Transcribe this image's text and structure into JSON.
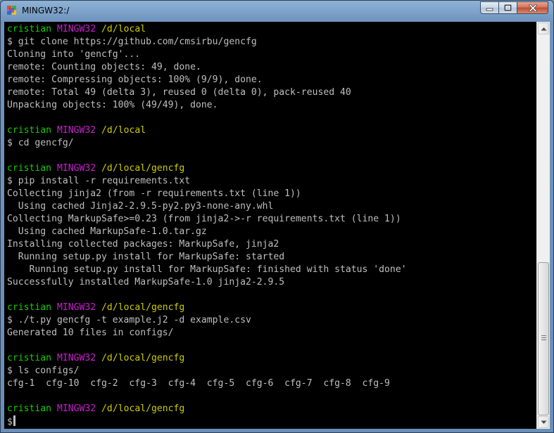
{
  "window": {
    "title": "MINGW32:/",
    "icon": "mingw-terminal-icon",
    "controls": [
      "minimize-icon",
      "maximize-icon",
      "close-icon"
    ]
  },
  "terminal": {
    "colors": {
      "user": "#19cb00",
      "host": "#cb1ed1",
      "path": "#cdcb00",
      "text": "#bfbfbf",
      "background": "#000000"
    },
    "lines": [
      {
        "type": "prompt",
        "user": "cristian",
        "host": "MINGW32",
        "path": "/d/local"
      },
      {
        "type": "text",
        "text": "$ git clone https://github.com/cmsirbu/gencfg"
      },
      {
        "type": "text",
        "text": "Cloning into 'gencfg'..."
      },
      {
        "type": "text",
        "text": "remote: Counting objects: 49, done."
      },
      {
        "type": "text",
        "text": "remote: Compressing objects: 100% (9/9), done."
      },
      {
        "type": "text",
        "text": "remote: Total 49 (delta 3), reused 0 (delta 0), pack-reused 40"
      },
      {
        "type": "text",
        "text": "Unpacking objects: 100% (49/49), done."
      },
      {
        "type": "text",
        "text": ""
      },
      {
        "type": "prompt",
        "user": "cristian",
        "host": "MINGW32",
        "path": "/d/local"
      },
      {
        "type": "text",
        "text": "$ cd gencfg/"
      },
      {
        "type": "text",
        "text": ""
      },
      {
        "type": "prompt",
        "user": "cristian",
        "host": "MINGW32",
        "path": "/d/local/gencfg"
      },
      {
        "type": "text",
        "text": "$ pip install -r requirements.txt"
      },
      {
        "type": "text",
        "text": "Collecting jinja2 (from -r requirements.txt (line 1))"
      },
      {
        "type": "text",
        "text": "  Using cached Jinja2-2.9.5-py2.py3-none-any.whl"
      },
      {
        "type": "text",
        "text": "Collecting MarkupSafe>=0.23 (from jinja2->-r requirements.txt (line 1))"
      },
      {
        "type": "text",
        "text": "  Using cached MarkupSafe-1.0.tar.gz"
      },
      {
        "type": "text",
        "text": "Installing collected packages: MarkupSafe, jinja2"
      },
      {
        "type": "text",
        "text": "  Running setup.py install for MarkupSafe: started"
      },
      {
        "type": "text",
        "text": "    Running setup.py install for MarkupSafe: finished with status 'done'"
      },
      {
        "type": "text",
        "text": "Successfully installed MarkupSafe-1.0 jinja2-2.9.5"
      },
      {
        "type": "text",
        "text": ""
      },
      {
        "type": "prompt",
        "user": "cristian",
        "host": "MINGW32",
        "path": "/d/local/gencfg"
      },
      {
        "type": "text",
        "text": "$ ./t.py gencfg -t example.j2 -d example.csv"
      },
      {
        "type": "text",
        "text": "Generated 10 files in configs/"
      },
      {
        "type": "text",
        "text": ""
      },
      {
        "type": "prompt",
        "user": "cristian",
        "host": "MINGW32",
        "path": "/d/local/gencfg"
      },
      {
        "type": "text",
        "text": "$ ls configs/"
      },
      {
        "type": "text",
        "text": "cfg-1  cfg-10  cfg-2  cfg-3  cfg-4  cfg-5  cfg-6  cfg-7  cfg-8  cfg-9"
      },
      {
        "type": "text",
        "text": ""
      },
      {
        "type": "prompt",
        "user": "cristian",
        "host": "MINGW32",
        "path": "/d/local/gencfg"
      },
      {
        "type": "cursor",
        "text": "$"
      }
    ]
  },
  "scrollbar": {
    "up_icon": "scroll-up-arrow-icon",
    "down_icon": "scroll-down-arrow-icon",
    "position": 0.59
  }
}
